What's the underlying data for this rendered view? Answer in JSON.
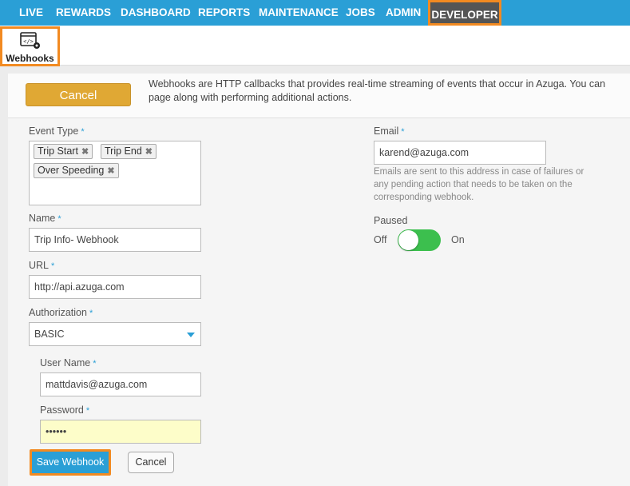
{
  "nav": {
    "items": [
      {
        "label": "LIVE"
      },
      {
        "label": "REWARDS"
      },
      {
        "label": "DASHBOARD"
      },
      {
        "label": "REPORTS"
      },
      {
        "label": "MAINTENANCE"
      },
      {
        "label": "JOBS"
      },
      {
        "label": "ADMIN"
      },
      {
        "label": "DEVELOPER",
        "active": true
      }
    ],
    "colors": {
      "bar": "#2a9fd6",
      "active_bg": "#555555",
      "highlight": "#f28a21"
    }
  },
  "subbar": {
    "webhooks_label": "Webhooks",
    "webhooks_icon": "code-window-gear-icon"
  },
  "header": {
    "cancel_label": "Cancel",
    "info_line1": "Webhooks are HTTP callbacks that provides real-time streaming of events that occur in Azuga. You can",
    "info_line2": "page along with performing additional actions."
  },
  "form": {
    "event_type": {
      "label": "Event Type",
      "required": "*",
      "tags": [
        "Trip Start",
        "Trip End",
        "Over Speeding"
      ],
      "remove_glyph": "✖"
    },
    "name": {
      "label": "Name",
      "required": "*",
      "value": "Trip Info- Webhook"
    },
    "url": {
      "label": "URL",
      "required": "*",
      "value": "http://api.azuga.com"
    },
    "authorization": {
      "label": "Authorization",
      "required": "*",
      "value": "BASIC"
    },
    "user_name": {
      "label": "User Name",
      "required": "*",
      "value": "mattdavis@azuga.com"
    },
    "password": {
      "label": "Password",
      "required": "*",
      "value": "••••••"
    },
    "email": {
      "label": "Email",
      "required": "*",
      "value": "karend@azuga.com",
      "help": "Emails are sent to this address in case of failures or any pending action that needs to be taken on the corresponding webhook."
    },
    "paused": {
      "label": "Paused",
      "off_label": "Off",
      "on_label": "On",
      "state": "on"
    }
  },
  "actions": {
    "save_label": "Save Webhook",
    "cancel_label": "Cancel"
  },
  "colors": {
    "accent": "#2a9fd6",
    "warning_button": "#e0a834",
    "toggle_on": "#3cbf4e"
  }
}
